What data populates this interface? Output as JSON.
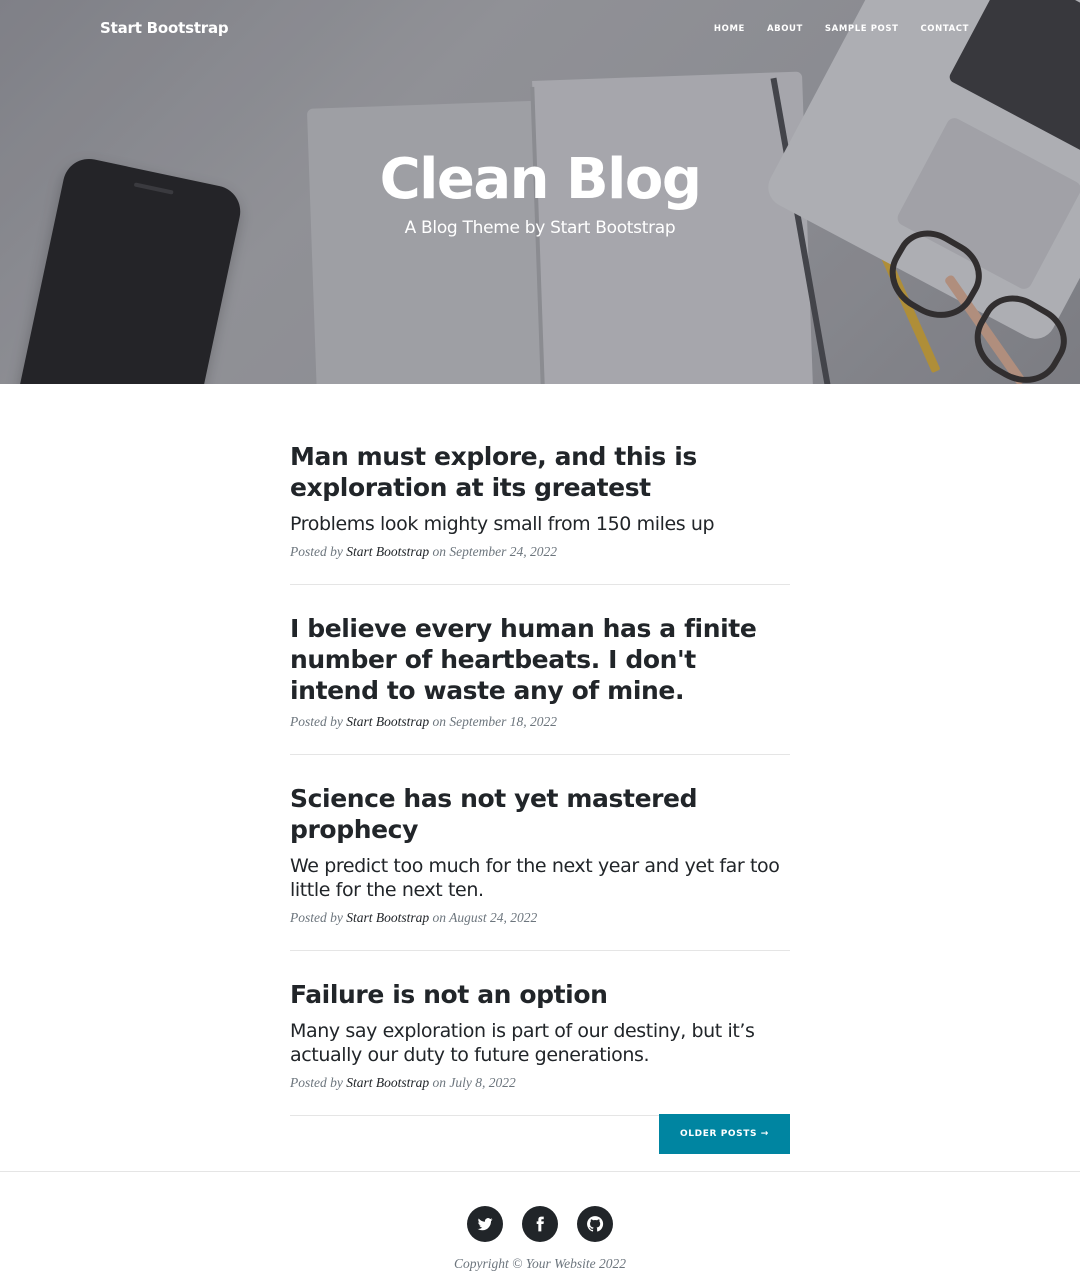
{
  "navbar": {
    "brand": "Start Bootstrap",
    "links": [
      "HOME",
      "ABOUT",
      "SAMPLE POST",
      "CONTACT"
    ]
  },
  "hero": {
    "title": "Clean Blog",
    "subtitle": "A Blog Theme by Start Bootstrap"
  },
  "posts": [
    {
      "title": "Man must explore, and this is exploration at its greatest",
      "subtitle": "Problems look mighty small from 150 miles up",
      "meta_prefix": "Posted by",
      "author": "Start Bootstrap",
      "meta_date": "on September 24, 2022"
    },
    {
      "title": "I believe every human has a finite number of heartbeats. I don't intend to waste any of mine.",
      "subtitle": "",
      "meta_prefix": "Posted by",
      "author": "Start Bootstrap",
      "meta_date": "on September 18, 2022"
    },
    {
      "title": "Science has not yet mastered prophecy",
      "subtitle": "We predict too much for the next year and yet far too little for the next ten.",
      "meta_prefix": "Posted by",
      "author": "Start Bootstrap",
      "meta_date": "on August 24, 2022"
    },
    {
      "title": "Failure is not an option",
      "subtitle": "Many say exploration is part of our destiny, but it’s actually our duty to future generations.",
      "meta_prefix": "Posted by",
      "author": "Start Bootstrap",
      "meta_date": "on July 8, 2022"
    }
  ],
  "pager": {
    "older_label": "OLDER POSTS →"
  },
  "footer": {
    "social_icons": [
      "twitter-icon",
      "facebook-icon",
      "github-icon"
    ],
    "copyright": "Copyright © Your Website 2022"
  },
  "colors": {
    "accent": "#0085a1",
    "text": "#212529",
    "muted": "#6c757d"
  }
}
